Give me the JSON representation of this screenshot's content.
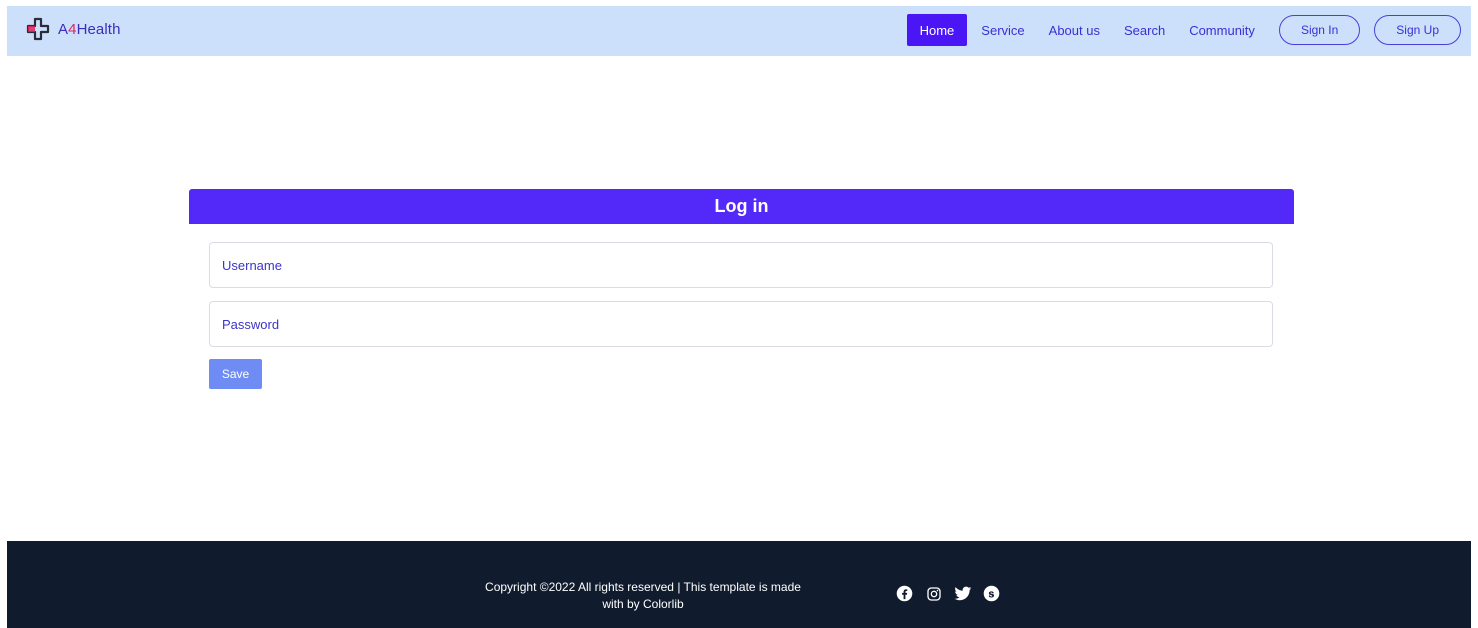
{
  "brand": {
    "prefix": "A",
    "digit": "4",
    "suffix": "Health",
    "logo_icon": "medical-cross-icon"
  },
  "nav": {
    "links": [
      {
        "label": "Home",
        "active": true
      },
      {
        "label": "Service",
        "active": false
      },
      {
        "label": "About us",
        "active": false
      },
      {
        "label": "Search",
        "active": false
      },
      {
        "label": "Community",
        "active": false
      }
    ],
    "signin_label": "Sign In",
    "signup_label": "Sign Up"
  },
  "login": {
    "title": "Log in",
    "username_placeholder": "Username",
    "password_placeholder": "Password",
    "save_label": "Save"
  },
  "footer": {
    "copyright_line1": "Copyright ©2022 All rights reserved | This template is made",
    "copyright_line2": "with by Colorlib",
    "social_icons": [
      "facebook-icon",
      "instagram-icon",
      "twitter-icon",
      "skype-icon"
    ]
  },
  "colors": {
    "navbar_bg": "#cde0fb",
    "accent": "#4b16f5",
    "login_header": "#5329fa",
    "save_button": "#6f8cf5",
    "footer_bg": "#101c2d",
    "brand_digit": "#e0245e"
  }
}
